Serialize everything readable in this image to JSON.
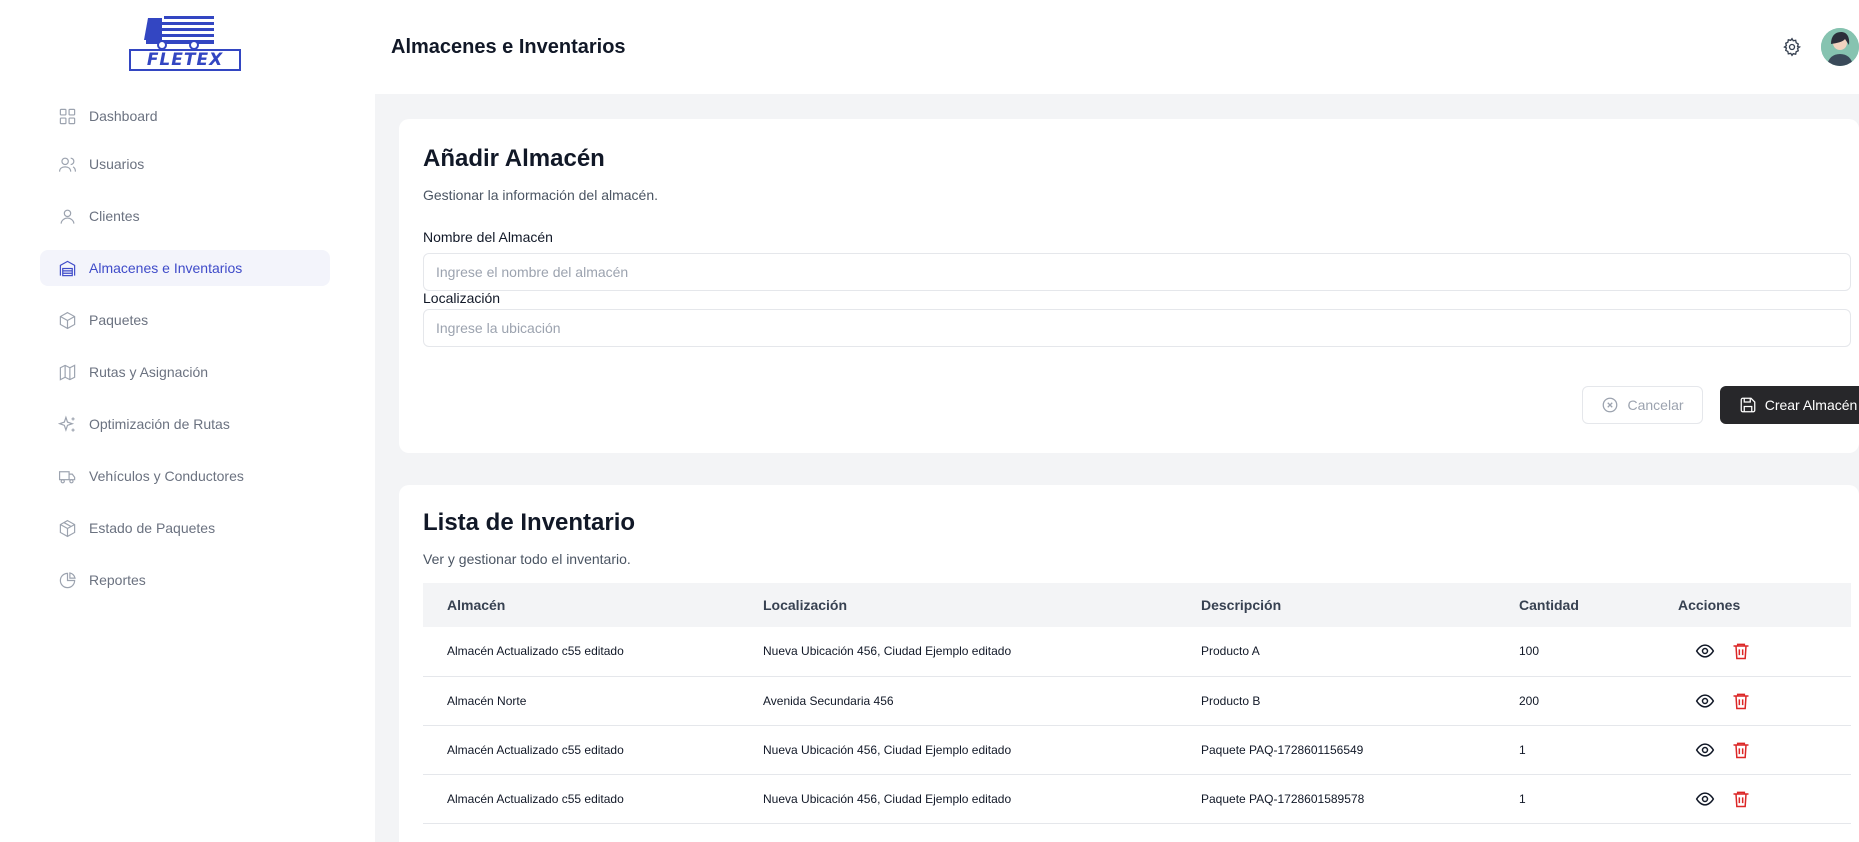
{
  "app": {
    "logo_text": "FLETEX",
    "page_title": "Almacenes e Inventarios"
  },
  "sidebar": {
    "items": [
      {
        "label": "Dashboard",
        "icon": "grid-icon"
      },
      {
        "label": "Usuarios",
        "icon": "users-icon"
      },
      {
        "label": "Clientes",
        "icon": "user-icon"
      },
      {
        "label": "Almacenes e Inventarios",
        "icon": "warehouse-icon",
        "active": true
      },
      {
        "label": "Paquetes",
        "icon": "package-icon"
      },
      {
        "label": "Rutas y Asignación",
        "icon": "map-icon"
      },
      {
        "label": "Optimización de Rutas",
        "icon": "sparkles-icon"
      },
      {
        "label": "Vehículos y Conductores",
        "icon": "truck-icon"
      },
      {
        "label": "Estado de Paquetes",
        "icon": "package-check-icon"
      },
      {
        "label": "Reportes",
        "icon": "pie-chart-icon"
      }
    ]
  },
  "form": {
    "title": "Añadir Almacén",
    "subtitle": "Gestionar la información del almacén.",
    "name_label": "Nombre del Almacén",
    "name_placeholder": "Ingrese el nombre del almacén",
    "name_value": "",
    "location_label": "Localización",
    "location_placeholder": "Ingrese la ubicación",
    "location_value": "",
    "cancel_label": "Cancelar",
    "create_label": "Crear Almacén"
  },
  "inventory": {
    "title": "Lista de Inventario",
    "subtitle": "Ver y gestionar todo el inventario.",
    "columns": [
      "Almacén",
      "Localización",
      "Descripción",
      "Cantidad",
      "Acciones"
    ],
    "rows": [
      {
        "almacen": "Almacén Actualizado c55 editado",
        "localizacion": "Nueva Ubicación 456, Ciudad Ejemplo editado",
        "descripcion": "Producto A",
        "cantidad": "100"
      },
      {
        "almacen": "Almacén Norte",
        "localizacion": "Avenida Secundaria 456",
        "descripcion": "Producto B",
        "cantidad": "200"
      },
      {
        "almacen": "Almacén Actualizado c55 editado",
        "localizacion": "Nueva Ubicación 456, Ciudad Ejemplo editado",
        "descripcion": "Paquete PAQ-1728601156549",
        "cantidad": "1"
      },
      {
        "almacen": "Almacén Actualizado c55 editado",
        "localizacion": "Nueva Ubicación 456, Ciudad Ejemplo editado",
        "descripcion": "Paquete PAQ-1728601589578",
        "cantidad": "1"
      }
    ]
  },
  "colors": {
    "accent": "#3f4bc9",
    "primary_button": "#27272a",
    "danger": "#dc2626",
    "background": "#f3f4f6"
  }
}
